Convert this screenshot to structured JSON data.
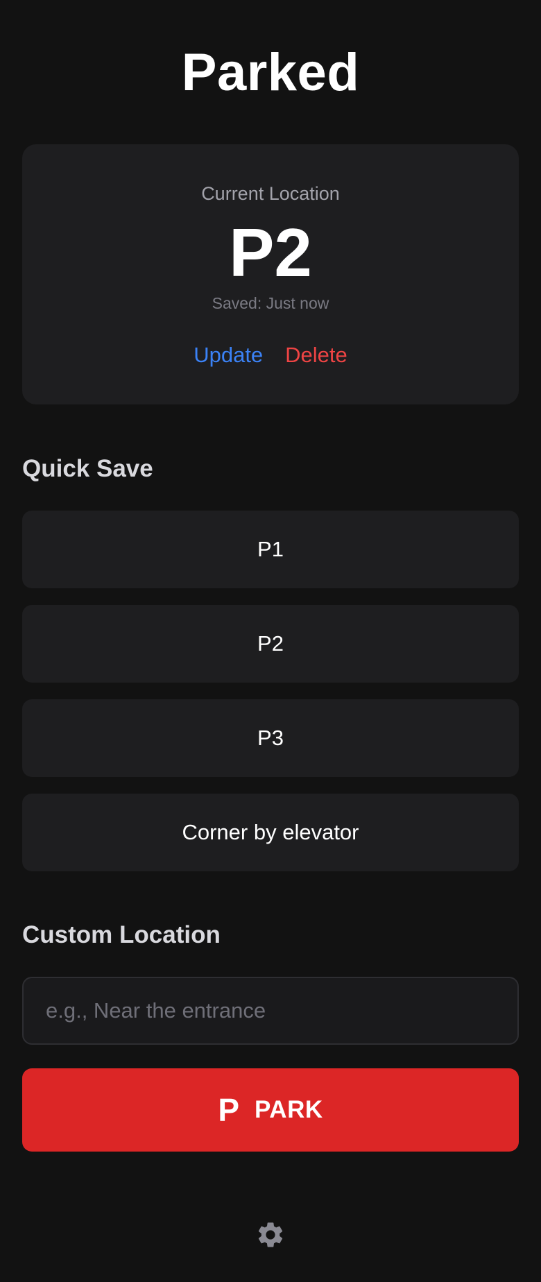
{
  "app": {
    "title": "Parked"
  },
  "current": {
    "label": "Current Location",
    "value": "P2",
    "saved": "Saved: Just now",
    "update_label": "Update",
    "delete_label": "Delete"
  },
  "quick_save": {
    "heading": "Quick Save",
    "options": [
      "P1",
      "P2",
      "P3",
      "Corner by elevator"
    ]
  },
  "custom": {
    "heading": "Custom Location",
    "placeholder": "e.g., Near the entrance",
    "value": ""
  },
  "park_button": {
    "icon": "P",
    "icon_name": "parking-icon",
    "label": "PARK"
  },
  "footer": {
    "icon_name": "gear-icon"
  },
  "colors": {
    "background": "#121212",
    "card": "#1e1e20",
    "accent_blue": "#3b82f6",
    "danger_red": "#ef4444",
    "park_red": "#dc2626"
  }
}
